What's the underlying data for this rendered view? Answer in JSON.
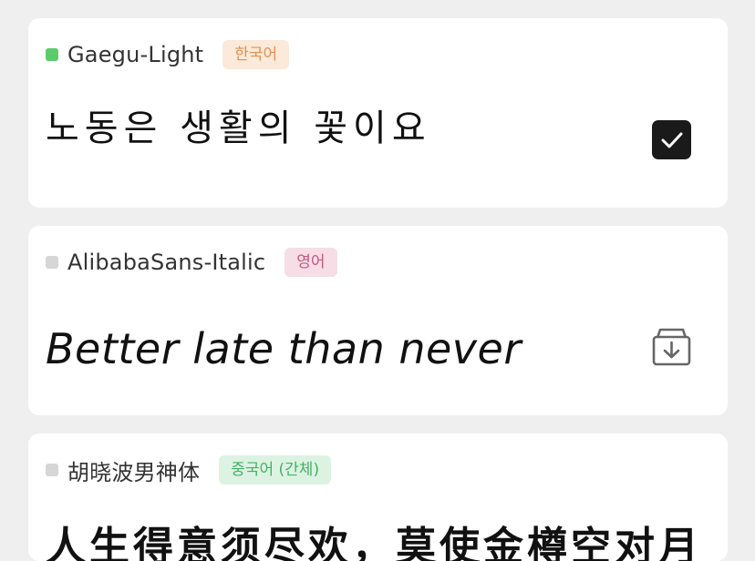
{
  "fonts": [
    {
      "name": "Gaegu-Light",
      "language": "한국어",
      "sample": "노동은 생활의 꽃이요",
      "status_color": "#5ccb6a",
      "badge_bg": "#fbe9d9",
      "badge_color": "#e09155",
      "action": "checked",
      "action_icon": "checkmark-icon"
    },
    {
      "name": "AlibabaSans-Italic",
      "language": "영어",
      "sample": "Better late than never",
      "status_color": "#d6d6d6",
      "badge_bg": "#f6dde6",
      "badge_color": "#c4587e",
      "action": "download",
      "action_icon": "download-box-icon"
    },
    {
      "name": "胡晓波男神体",
      "language": "중국어 (간체)",
      "sample": "人生得意须尽欢，莫使金樽空对月",
      "status_color": "#d6d6d6",
      "badge_bg": "#dcf3e2",
      "badge_color": "#45b068",
      "action": "none",
      "action_icon": ""
    }
  ]
}
